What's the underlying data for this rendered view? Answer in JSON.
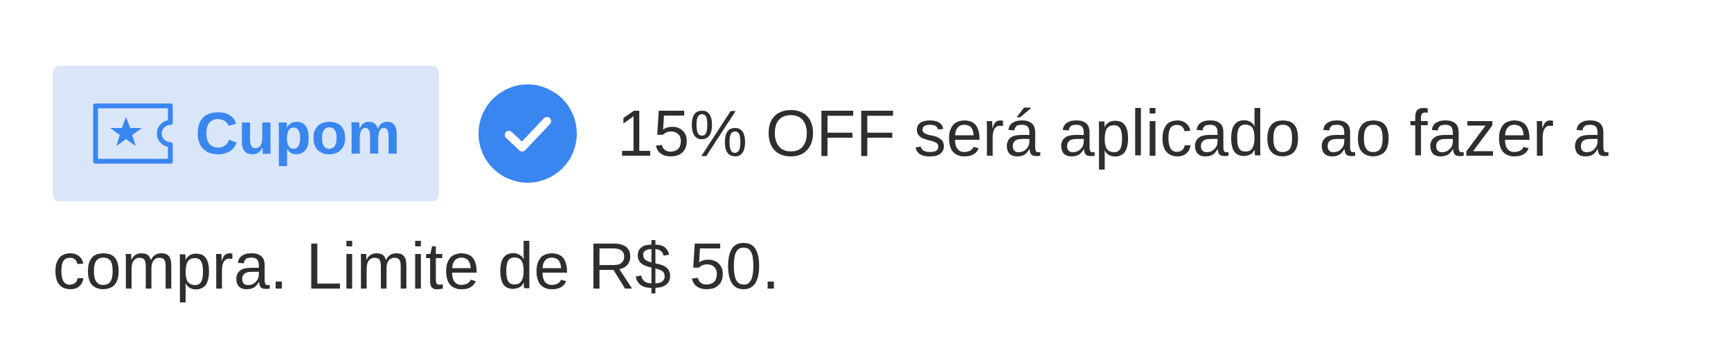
{
  "coupon": {
    "label": "Cupom"
  },
  "applied": true,
  "message_lines": [
    "15% OFF será aplicado ao fazer a",
    "compra. Limite de R$ 50."
  ]
}
